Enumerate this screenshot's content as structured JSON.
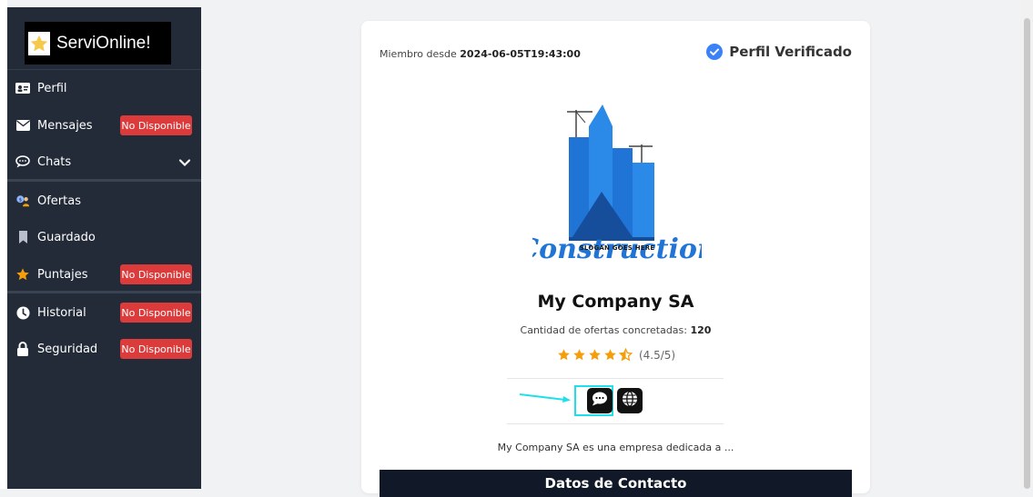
{
  "brand": {
    "name": "ServiOnline!",
    "icon": "star-icon"
  },
  "sidebar": {
    "items": [
      {
        "label": "Perfil",
        "icon": "id-card-icon",
        "badge": ""
      },
      {
        "label": "Mensajes",
        "icon": "envelope-icon",
        "badge": "No Disponible"
      },
      {
        "label": "Chats",
        "icon": "chat-bubble-icon",
        "badge": "",
        "expandable": true
      },
      {
        "label": "Ofertas",
        "icon": "users-money-icon",
        "badge": ""
      },
      {
        "label": "Guardado",
        "icon": "bookmark-icon",
        "badge": ""
      },
      {
        "label": "Puntajes",
        "icon": "star-icon",
        "badge": "No Disponible"
      },
      {
        "label": "Historial",
        "icon": "clock-icon",
        "badge": "No Disponible"
      },
      {
        "label": "Seguridad",
        "icon": "lock-icon",
        "badge": "No Disponible"
      }
    ]
  },
  "profile": {
    "member_since_label": "Miembro desde",
    "member_since_value": "2024-06-05T19:43:00",
    "verified_label": "Perfil Verificado",
    "logo": {
      "title": "Construction",
      "slogan": "SLOGAN GOES HERE"
    },
    "company_name": "My Company SA",
    "offers_label": "Cantidad de ofertas concretadas:",
    "offers_count": "120",
    "rating": 4.5,
    "rating_text": "(4.5/5)",
    "description": "My Company SA es una empresa dedicada a ...",
    "contact_header": "Datos de Contacto",
    "actions": [
      {
        "icon": "chat-icon"
      },
      {
        "icon": "globe-icon"
      }
    ]
  },
  "colors": {
    "sidebar_bg": "#232b38",
    "badge_red": "#dc3b3b",
    "verified_blue": "#3b82f6",
    "star_orange": "#f59e0b",
    "logo_blue": "#1f74d6",
    "highlight_cyan": "#1ee0e8"
  }
}
